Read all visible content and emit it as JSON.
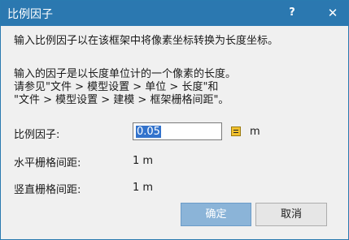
{
  "title": "比例因子",
  "help_label": "?",
  "close_label": "✕",
  "description": "输入比例因子以在该框架中将像素坐标转换为长度坐标。",
  "info_lines": [
    "输入的因子是以长度单位计的一个像素的长度。",
    "请参见\"文件 > 模型设置 > 单位 > 长度\"和",
    "\"文件 > 模型设置 > 建模 > 框架栅格间距\"。"
  ],
  "fields": {
    "scale_label": "比例因子:",
    "scale_value": "0.05",
    "scale_unit": "m",
    "horizontal_label": "水平栅格间距:",
    "horizontal_value": "1 m",
    "vertical_label": "竖直栅格间距:",
    "vertical_value": "1 m"
  },
  "buttons": {
    "ok": "确定",
    "cancel": "取消"
  },
  "colors": {
    "titlebar": "#2b78b0",
    "ok_button": "#8bb4d8",
    "selection": "#3373cc"
  }
}
